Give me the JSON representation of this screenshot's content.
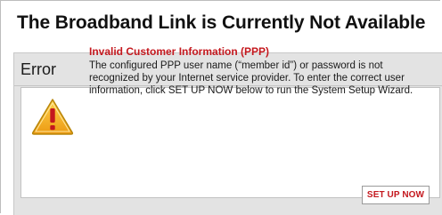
{
  "page": {
    "title": "The Broadband Link is Currently Not Available"
  },
  "panel": {
    "heading": "Error"
  },
  "message": {
    "icon": "warning-triangle-icon",
    "title": "Invalid Customer Information (PPP)",
    "body": "The configured PPP user name (“member id”) or password is not recognized by your Internet service provider. To enter the correct user information, click SET UP NOW below to run the System Setup Wizard."
  },
  "actions": {
    "setup_label": "SET UP NOW"
  },
  "colors": {
    "accent_red": "#c4181e",
    "icon_fill": "#f2b31e"
  }
}
